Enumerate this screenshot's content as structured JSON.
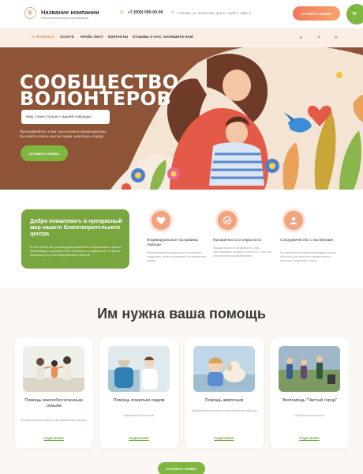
{
  "header": {
    "company_name": "Название компании",
    "company_sub": "благотворительная организация",
    "phone": "+7 (000) 000-00-00",
    "address": "г. Москва, ул. Ленинская, дом 5, строй 9, офис 3",
    "cta": "ОСТАВИТЬ ЗАЯВКУ",
    "corner": "76"
  },
  "nav": {
    "items": [
      "О ПРОЕКТАХ",
      "УСЛУГИ",
      "ПРАЙС-ЛИСТ",
      "КОНТАКТЫ",
      "ОТЗЫВЫ О НАС",
      "НАПИШИТЕ НАМ"
    ],
    "icons": [
      "vk-icon",
      "telegram-icon"
    ]
  },
  "hero": {
    "title_line1": "СООБЩЕСТВО",
    "title_line2": "ВОЛОНТЕРОВ",
    "tagline": "Мир станет лучше с вашей помощью",
    "text_line1": "Присоединяйтесь к нам, волонтерам и неравнодушным.",
    "text_line2": "Вы можете помочь многим людям, животным и городу",
    "cta": "ОСТАВИТЬ ЗАЯВКУ"
  },
  "welcome": {
    "title": "Добро пожаловать в прекрасный мир нашего благотворительного центра",
    "text": "В этом блоке мы рекомендуем разместить информацию о вашей организации, подчеркнуть ее значимость и надежность на рынке оказания услуг или предлагаемых товаров",
    "features": [
      {
        "title": "Индивидуальные программы помощи",
        "text": "Разрабатываем специальные программы поддержки, ориентированные на конкретные нужды"
      },
      {
        "title": "Прозрачность и открытость",
        "text": "Каждый взнос отслеживается, а мы обеспечиваем полную отчетность о том, как используются пожертвования"
      },
      {
        "title": "Сотрудничество с экспертами",
        "text": "Мы работаем с профессионалами разных областей для наиболее эффективного решения социальных задач"
      }
    ]
  },
  "help": {
    "title": "Им нужна ваша помощь",
    "cards": [
      {
        "title": "Помощь малообеспеченным семьям",
        "text": "Требуются волонтеры и материальная помощь",
        "link": "ПОДРОБНЕЕ"
      },
      {
        "title": "Помощь пожилым людям",
        "text": "Требуются волонтеры",
        "link": "ПОДРОБНЕЕ"
      },
      {
        "title": "Помощь животным",
        "text": "Требуются волонтеры и материальная помощь",
        "link": "ПОДРОБНЕЕ"
      },
      {
        "title": "Экопомощь \"Чистый город\"",
        "text": "Требуются волонтеры",
        "link": "ПОДРОБНЕЕ"
      }
    ],
    "cta": "ОСТАВИТЬ ЗАЯВКУ"
  },
  "colors": {
    "accent_orange": "#f2785a",
    "accent_green": "#7fb640",
    "hero_brown": "#8e5438"
  }
}
